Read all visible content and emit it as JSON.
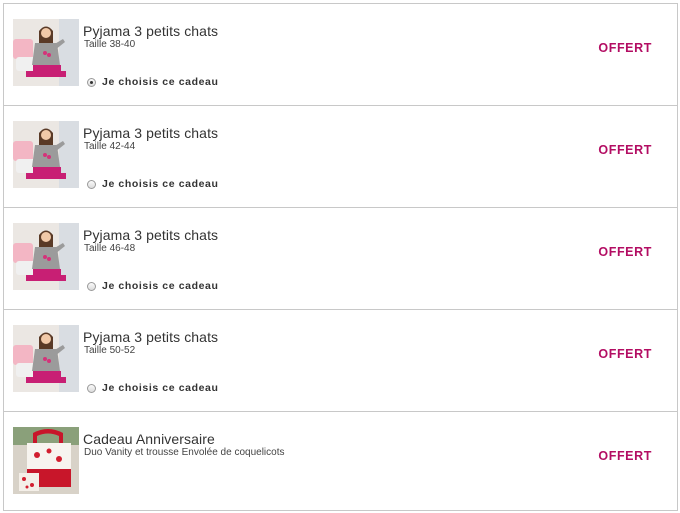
{
  "colors": {
    "accent": "#b30d63",
    "border": "#c8c8c8",
    "text": "#333333"
  },
  "gifts": [
    {
      "title": "Pyjama 3 petits chats",
      "subtitle": "Taille 38-40",
      "choice_label": "Je choisis ce cadeau",
      "selected": true,
      "price_label": "OFFERT",
      "image": "pyjama-photo"
    },
    {
      "title": "Pyjama 3 petits chats",
      "subtitle": "Taille 42-44",
      "choice_label": "Je choisis ce cadeau",
      "selected": false,
      "price_label": "OFFERT",
      "image": "pyjama-photo"
    },
    {
      "title": "Pyjama 3 petits chats",
      "subtitle": "Taille 46-48",
      "choice_label": "Je choisis ce cadeau",
      "selected": false,
      "price_label": "OFFERT",
      "image": "pyjama-photo"
    },
    {
      "title": "Pyjama 3 petits chats",
      "subtitle": "Taille 50-52",
      "choice_label": "Je choisis ce cadeau",
      "selected": false,
      "price_label": "OFFERT",
      "image": "pyjama-photo"
    },
    {
      "title": "Cadeau Anniversaire",
      "subtitle": "Duo Vanity et trousse Envolée de coquelicots",
      "price_label": "OFFERT",
      "image": "vanity-bag-photo"
    }
  ]
}
